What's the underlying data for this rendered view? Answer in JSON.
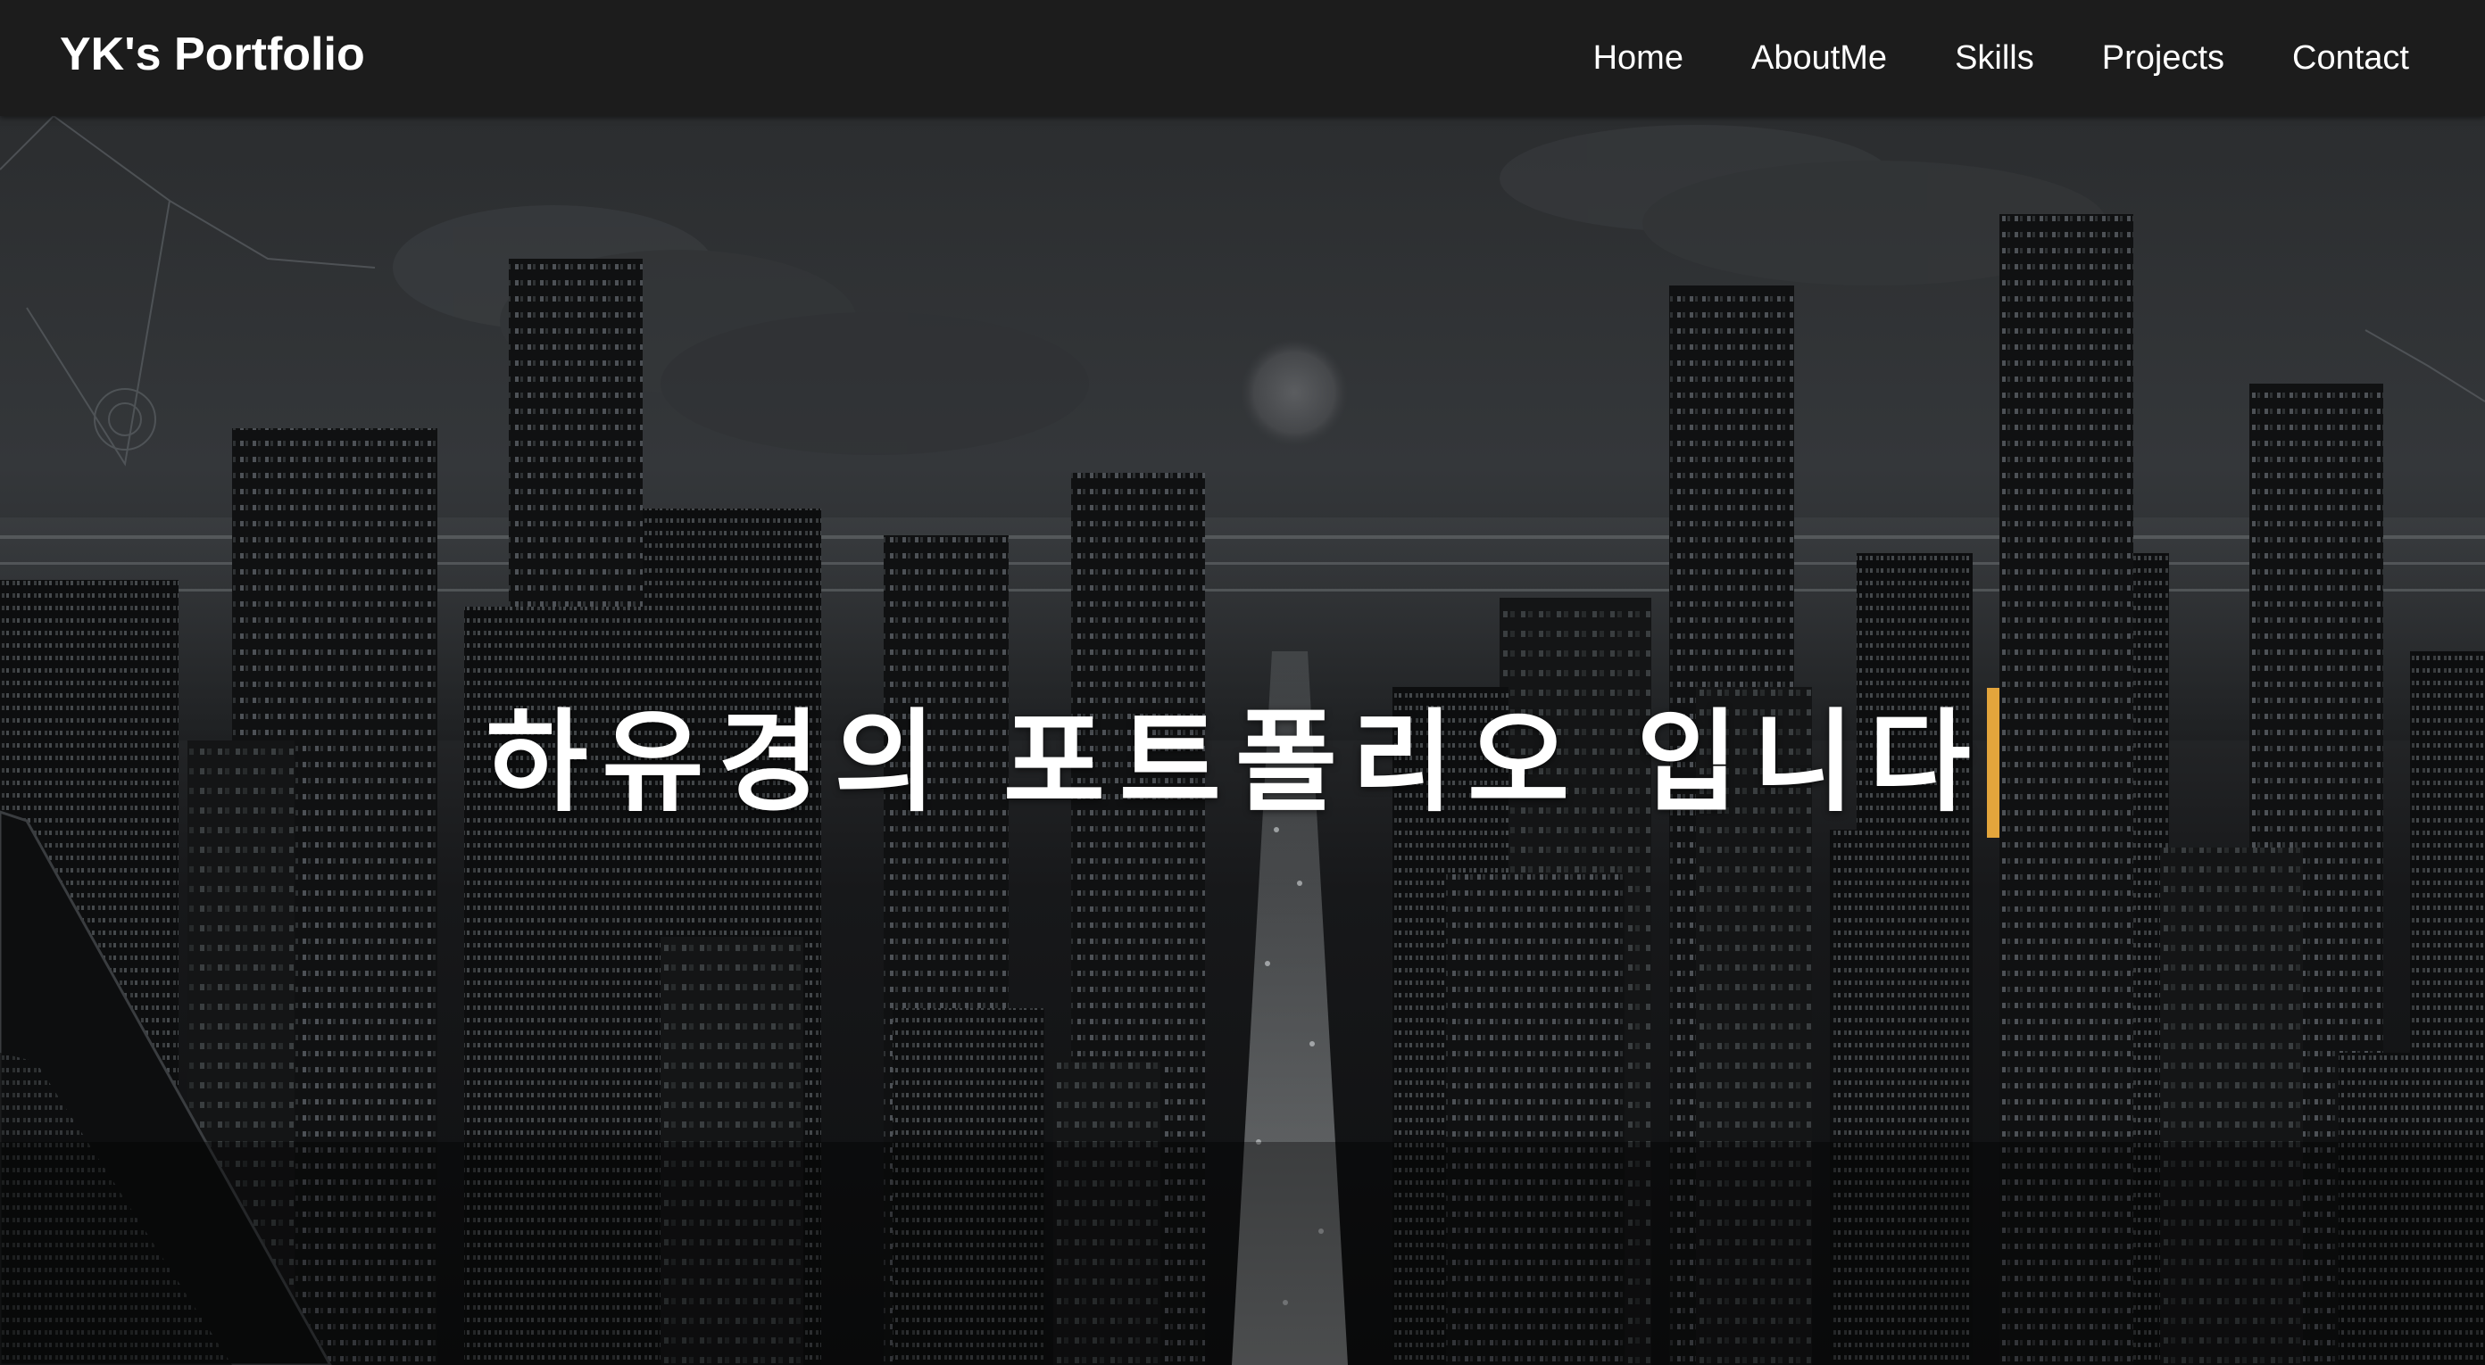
{
  "header": {
    "brand": "YK's Portfolio",
    "nav": [
      {
        "label": "Home"
      },
      {
        "label": "AboutMe"
      },
      {
        "label": "Skills"
      },
      {
        "label": "Projects"
      },
      {
        "label": "Contact"
      }
    ]
  },
  "hero": {
    "title": "하유경의 포트폴리오 입니다",
    "cursor_color": "#e3a53c",
    "background": "dark night city skyline with skyscrapers, a dim moon and clouds"
  },
  "colors": {
    "navbar_bg": "#1c1c1c",
    "text": "#ffffff",
    "accent": "#e3a53c"
  }
}
